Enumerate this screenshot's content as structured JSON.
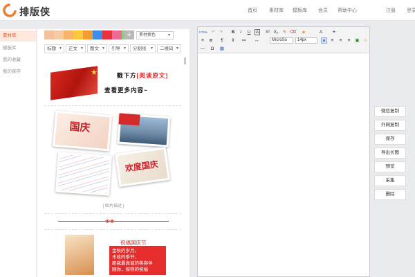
{
  "app": {
    "logo_text": "排版侠"
  },
  "nav": {
    "items": [
      "首页",
      "素材库",
      "模板库",
      "会员",
      "帮助中心"
    ],
    "login": "注册",
    "register": "登录"
  },
  "sidebar": {
    "items": [
      {
        "label": "素材库",
        "active": true
      },
      {
        "label": "模板库",
        "active": false
      },
      {
        "label": "我的收藏",
        "active": false
      },
      {
        "label": "我的保存",
        "active": false
      }
    ]
  },
  "panel": {
    "swatches": [
      "#f4bf9d",
      "#f6caa2",
      "#f8b46d",
      "#fbc83b",
      "#f39c33",
      "#3d8ee8",
      "#e8323c",
      "#ec6a93",
      "#8ad07a"
    ],
    "color_select": "素材换色",
    "filters": [
      "标题",
      "正文",
      "图文",
      "引导",
      "分割线",
      "二维码"
    ],
    "banner": {
      "line1_prefix": "戳下方",
      "line1_highlight": "[阅读原文]",
      "line2": "查看更多内容~"
    },
    "photo_caption": "[ 图片描述 ]",
    "lower_title": "祝福国庆节",
    "lower_lines": [
      "金秋的岁月，",
      "丰收的季节，",
      "愿我最真诚的笑容伴",
      "随你，探得的祝福"
    ]
  },
  "editor": {
    "toolbar_row1": [
      "HTML",
      "↶",
      "↷",
      "B",
      "I",
      "U",
      "A",
      "X²",
      "X₂",
      "✎",
      "⌫",
      "◈",
      "A",
      "✦"
    ],
    "toolbar_row2": [
      "≡",
      "≣",
      "¶",
      "⇕",
      "≔",
      "↔"
    ],
    "font_family": "MicroSo",
    "font_size": "14px",
    "toolbar_row3": [
      "—",
      "Ω",
      "▦"
    ]
  },
  "actions": [
    "微信复制",
    "外网复制",
    "保存",
    "导出长图",
    "预览",
    "采集",
    "删除"
  ]
}
